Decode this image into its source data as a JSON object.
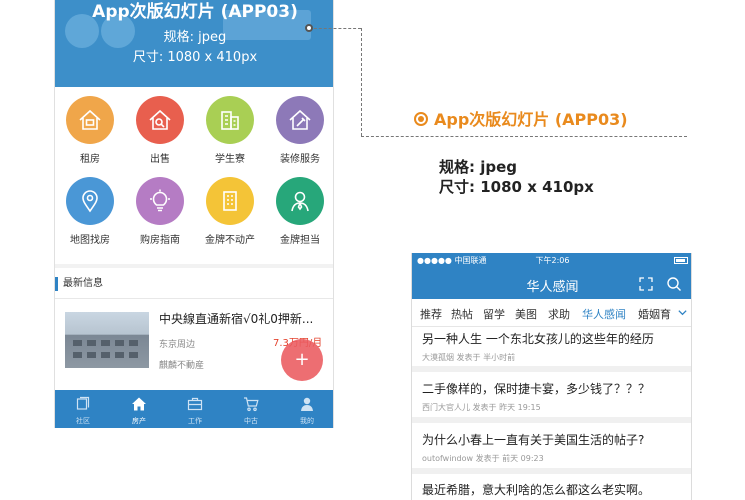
{
  "left_phone": {
    "banner": {
      "title": "App次版幻灯片 (APP03)",
      "spec_format": "规格:  jpeg",
      "spec_size": "尺寸:  1080 x 410px"
    },
    "services": [
      {
        "label": "租房",
        "icon": "house-icon",
        "color": "#f0a64a"
      },
      {
        "label": "出售",
        "icon": "house-search-icon",
        "color": "#e85f4e"
      },
      {
        "label": "学生寮",
        "icon": "building-icon",
        "color": "#a9cf54"
      },
      {
        "label": "装修服务",
        "icon": "tools-icon",
        "color": "#8d79b8"
      },
      {
        "label": "地图找房",
        "icon": "map-pin-icon",
        "color": "#4a97d6"
      },
      {
        "label": "购房指南",
        "icon": "lightbulb-icon",
        "color": "#b57cc4"
      },
      {
        "label": "金牌不动产",
        "icon": "office-building-icon",
        "color": "#f4c437"
      },
      {
        "label": "金牌担当",
        "icon": "agent-icon",
        "color": "#27a77a"
      }
    ],
    "latest": {
      "heading": "最新信息",
      "listing": {
        "title": "中央線直通新宿√0礼0押新...",
        "location": "东京周边",
        "price": "7.3万円/月",
        "agent": "麒麟不動産"
      }
    },
    "tabs": [
      {
        "label": "社区",
        "icon": "community-icon",
        "active": false
      },
      {
        "label": "房产",
        "icon": "home-icon",
        "active": true
      },
      {
        "label": "工作",
        "icon": "briefcase-icon",
        "active": false
      },
      {
        "label": "中古",
        "icon": "cart-icon",
        "active": false
      },
      {
        "label": "我的",
        "icon": "user-icon",
        "active": false
      }
    ]
  },
  "callout": {
    "title": "App次版幻灯片 (APP03)",
    "spec_format": "规格:  jpeg",
    "spec_size": "尺寸:  1080 x 410px",
    "accent_color": "#e98a1d"
  },
  "right_phone": {
    "status": {
      "carrier": "●●●●● 中国联通",
      "time": "下午2:06"
    },
    "nav_title": "华人感闻",
    "channels": [
      {
        "label": "推荐",
        "active": false
      },
      {
        "label": "热帖",
        "active": false
      },
      {
        "label": "留学",
        "active": false
      },
      {
        "label": "美图",
        "active": false
      },
      {
        "label": "求助",
        "active": false
      },
      {
        "label": "华人感闻",
        "active": true
      },
      {
        "label": "婚姻育",
        "active": false
      }
    ],
    "articles": [
      {
        "title": "另一种人生 一个东北女孩儿的这些年的经历",
        "meta": "大漠孤烟 发表于 半小时前"
      },
      {
        "title": "二手像样的，保时捷卡宴，多少钱了？？？",
        "meta": "西门大官人儿 发表于 昨天 19:15"
      },
      {
        "title": "为什么小春上一直有关于美国生活的帖子?",
        "meta": "outofwindow 发表于 前天 09:23"
      },
      {
        "title": "最近希腊，意大利啥的怎么都这么老实啊。",
        "meta": ""
      }
    ]
  },
  "theme": {
    "primary_blue": "#2f83c4",
    "price_red": "#e4442f"
  }
}
